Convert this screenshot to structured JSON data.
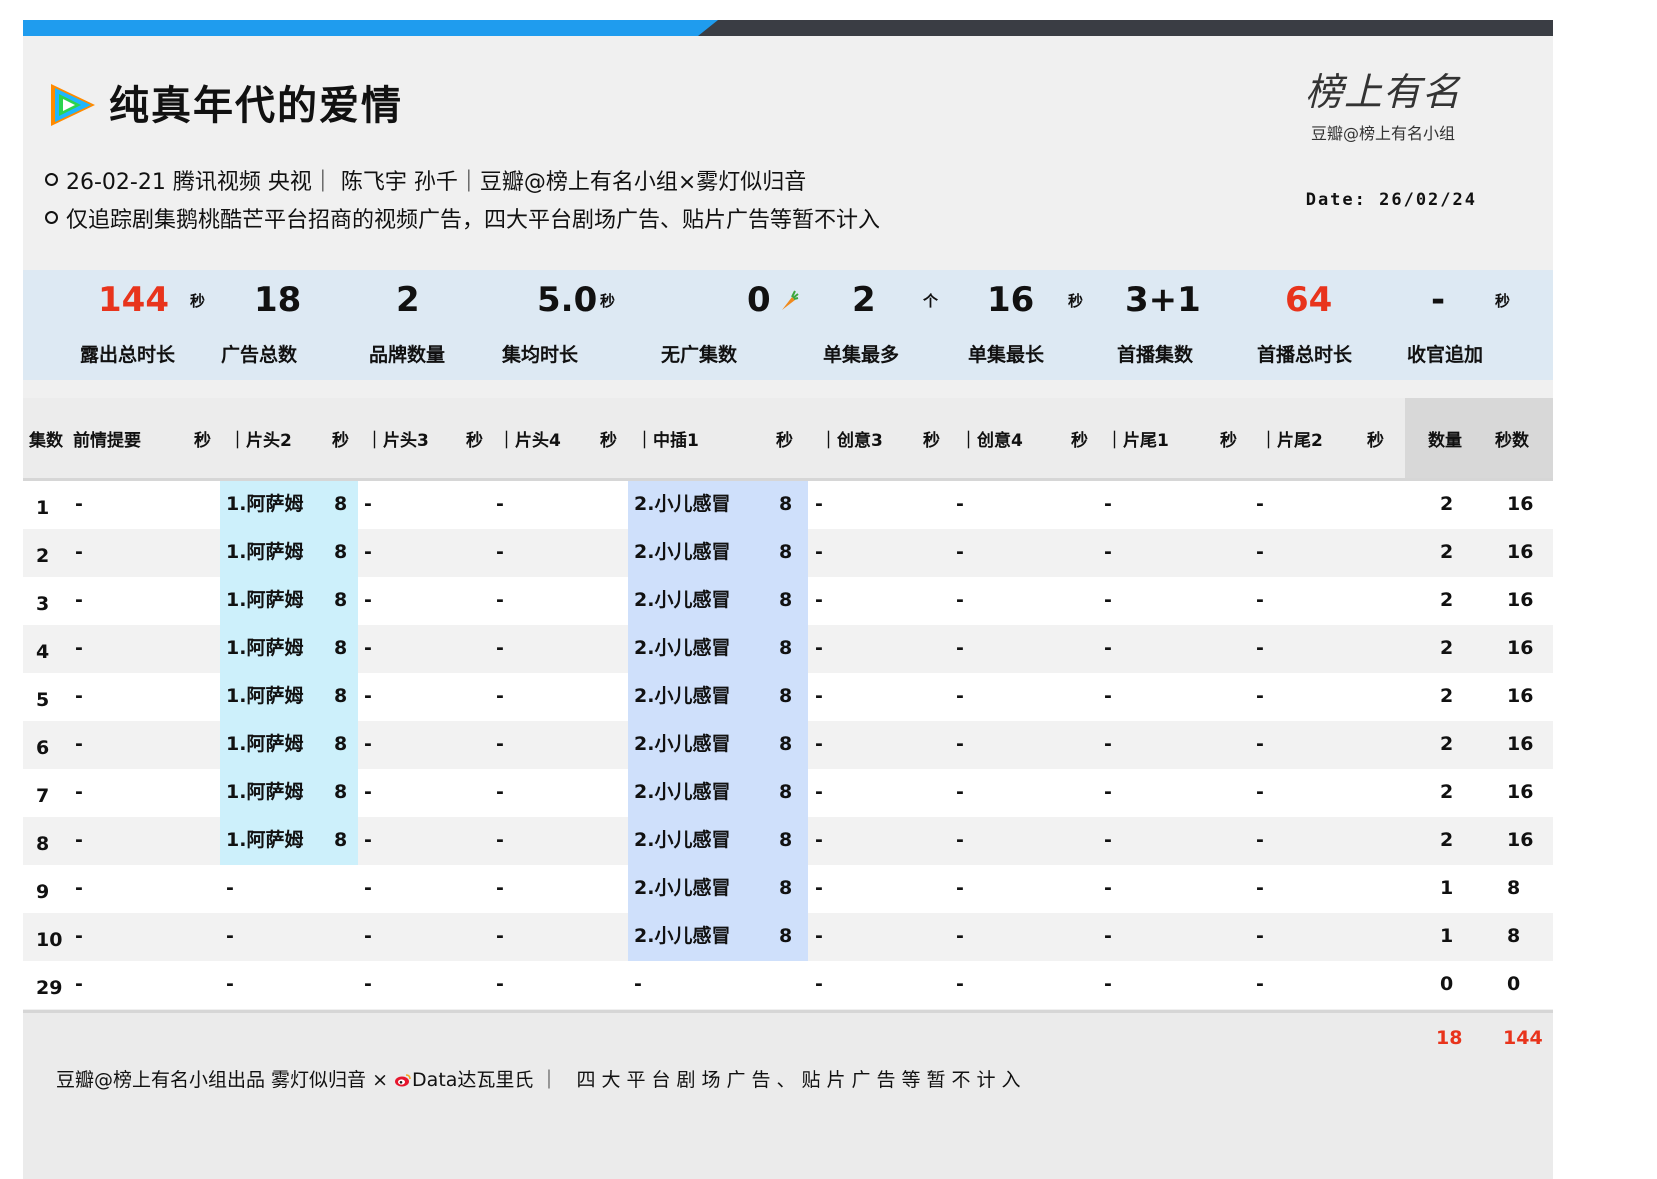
{
  "title": "纯真年代的爱情",
  "meta": {
    "line1": "26-02-21 腾讯视频 央视｜ 陈飞宇 孙千｜豆瓣@榜上有名小组×雾灯似归音",
    "line2": "仅追踪剧集鹅桃酷芒平台招商的视频广告，四大平台剧场广告、贴片广告等暂不计入"
  },
  "brand": {
    "script": "榜上有名",
    "sub": "豆瓣@榜上有名小组"
  },
  "date": "Date: 26/02/24",
  "colors": {
    "accent_blue": "#1f9cee",
    "red": "#e8341c",
    "band_a": "#cdf0fb",
    "band_b": "#cfe0fb"
  },
  "stats": [
    {
      "value": "144",
      "unit": "秒",
      "label": "露出总时长",
      "red": true
    },
    {
      "value": "18",
      "unit": "",
      "label": "广告总数"
    },
    {
      "value": "2",
      "unit": "",
      "label": "品牌数量"
    },
    {
      "value": "5.0",
      "unit": "秒",
      "label": "集均时长"
    },
    {
      "value": "0",
      "unit": "",
      "label": "无广集数",
      "icon": "carrot-icon"
    },
    {
      "value": "2",
      "unit": "个",
      "label": "单集最多"
    },
    {
      "value": "16",
      "unit": "秒",
      "label": "单集最长"
    },
    {
      "value": "3+1",
      "unit": "",
      "label": "首播集数"
    },
    {
      "value": "64",
      "unit": "",
      "label": "首播总时长",
      "red": true
    },
    {
      "value": "-",
      "unit": "秒",
      "label": "收官追加"
    }
  ],
  "headers": [
    "集数",
    "前情提要",
    "秒",
    "｜片头2",
    "秒",
    "｜片头3",
    "秒",
    "｜片头4",
    "秒",
    "｜中插1",
    "秒",
    "｜创意3",
    "秒",
    "｜创意4",
    "秒",
    "｜片尾1",
    "秒",
    "｜片尾2",
    "秒",
    "数量",
    "秒数"
  ],
  "rows": [
    {
      "ep": "1",
      "recap": "-",
      "head2": "1.阿萨姆",
      "head2s": "8",
      "head3": "-",
      "head4": "-",
      "mid1": "2.小儿感冒",
      "mid1s": "8",
      "c3": "-",
      "c4": "-",
      "end1": "-",
      "end2": "-",
      "count": "2",
      "secs": "16"
    },
    {
      "ep": "2",
      "recap": "-",
      "head2": "1.阿萨姆",
      "head2s": "8",
      "head3": "-",
      "head4": "-",
      "mid1": "2.小儿感冒",
      "mid1s": "8",
      "c3": "-",
      "c4": "-",
      "end1": "-",
      "end2": "-",
      "count": "2",
      "secs": "16"
    },
    {
      "ep": "3",
      "recap": "-",
      "head2": "1.阿萨姆",
      "head2s": "8",
      "head3": "-",
      "head4": "-",
      "mid1": "2.小儿感冒",
      "mid1s": "8",
      "c3": "-",
      "c4": "-",
      "end1": "-",
      "end2": "-",
      "count": "2",
      "secs": "16"
    },
    {
      "ep": "4",
      "recap": "-",
      "head2": "1.阿萨姆",
      "head2s": "8",
      "head3": "-",
      "head4": "-",
      "mid1": "2.小儿感冒",
      "mid1s": "8",
      "c3": "-",
      "c4": "-",
      "end1": "-",
      "end2": "-",
      "count": "2",
      "secs": "16"
    },
    {
      "ep": "5",
      "recap": "-",
      "head2": "1.阿萨姆",
      "head2s": "8",
      "head3": "-",
      "head4": "-",
      "mid1": "2.小儿感冒",
      "mid1s": "8",
      "c3": "-",
      "c4": "-",
      "end1": "-",
      "end2": "-",
      "count": "2",
      "secs": "16"
    },
    {
      "ep": "6",
      "recap": "-",
      "head2": "1.阿萨姆",
      "head2s": "8",
      "head3": "-",
      "head4": "-",
      "mid1": "2.小儿感冒",
      "mid1s": "8",
      "c3": "-",
      "c4": "-",
      "end1": "-",
      "end2": "-",
      "count": "2",
      "secs": "16"
    },
    {
      "ep": "7",
      "recap": "-",
      "head2": "1.阿萨姆",
      "head2s": "8",
      "head3": "-",
      "head4": "-",
      "mid1": "2.小儿感冒",
      "mid1s": "8",
      "c3": "-",
      "c4": "-",
      "end1": "-",
      "end2": "-",
      "count": "2",
      "secs": "16"
    },
    {
      "ep": "8",
      "recap": "-",
      "head2": "1.阿萨姆",
      "head2s": "8",
      "head3": "-",
      "head4": "-",
      "mid1": "2.小儿感冒",
      "mid1s": "8",
      "c3": "-",
      "c4": "-",
      "end1": "-",
      "end2": "-",
      "count": "2",
      "secs": "16"
    },
    {
      "ep": "9",
      "recap": "-",
      "head2": "-",
      "head2s": "",
      "head3": "-",
      "head4": "-",
      "mid1": "2.小儿感冒",
      "mid1s": "8",
      "c3": "-",
      "c4": "-",
      "end1": "-",
      "end2": "-",
      "count": "1",
      "secs": "8"
    },
    {
      "ep": "10",
      "recap": "-",
      "head2": "-",
      "head2s": "",
      "head3": "-",
      "head4": "-",
      "mid1": "2.小儿感冒",
      "mid1s": "8",
      "c3": "-",
      "c4": "-",
      "end1": "-",
      "end2": "-",
      "count": "1",
      "secs": "8"
    },
    {
      "ep": "29",
      "recap": "-",
      "head2": "-",
      "head2s": "",
      "head3": "-",
      "head4": "-",
      "mid1": "-",
      "mid1s": "",
      "c3": "-",
      "c4": "-",
      "end1": "-",
      "end2": "-",
      "count": "0",
      "secs": "0"
    }
  ],
  "totals": {
    "count": "18",
    "secs": "144"
  },
  "footer": {
    "lead": "豆瓣@榜上有名小组出品 雾灯似归音 ×",
    "weibo": "Data达瓦里氏",
    "note": "｜ 四大平台剧场广告、贴片广告等暂不计入"
  }
}
